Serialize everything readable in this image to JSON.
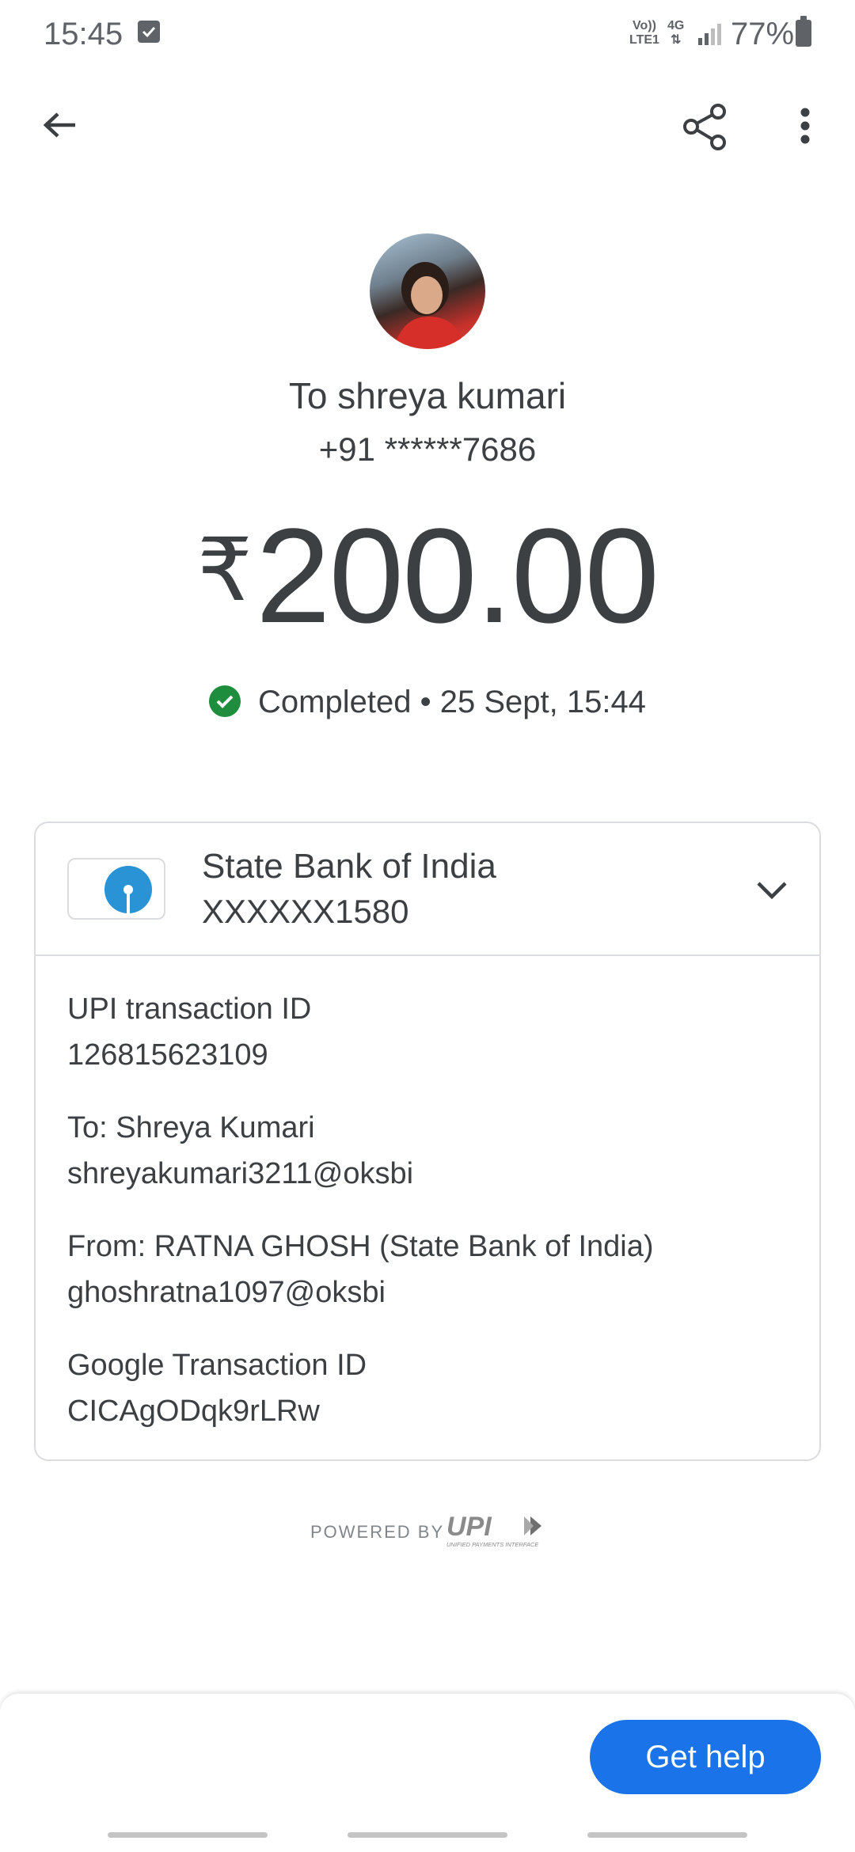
{
  "status_bar": {
    "time": "15:45",
    "network_top": "Vo))",
    "network_bottom": "LTE1",
    "data_type": "4G",
    "battery": "77%"
  },
  "app_bar": {
    "back_icon": "arrow-back-icon",
    "share_icon": "share-icon",
    "more_icon": "more-vert-icon"
  },
  "payment": {
    "recipient": "To shreya kumari",
    "phone": "+91 ******7686",
    "currency_symbol": "₹",
    "amount": "200.00",
    "status": "Completed • 25 Sept, 15:44",
    "status_color": "#1e8e3e"
  },
  "bank": {
    "name": "State Bank of India",
    "account": "XXXXXX1580"
  },
  "details": [
    {
      "label": "UPI transaction ID",
      "value": "126815623109"
    },
    {
      "label": "To: Shreya  Kumari",
      "value": "shreyakumari3211@oksbi"
    },
    {
      "label": "From: RATNA  GHOSH (State Bank of India)",
      "value": "ghoshratna1097@oksbi"
    },
    {
      "label": "Google Transaction ID",
      "value": "CICAgODqk9rLRw"
    }
  ],
  "footer": {
    "powered_by": "POWERED BY",
    "upi_logo_text": "UPI",
    "upi_logo_subtext": "UNIFIED PAYMENTS INTERFACE"
  },
  "actions": {
    "help_label": "Get help",
    "accent_color": "#1a73e8"
  }
}
